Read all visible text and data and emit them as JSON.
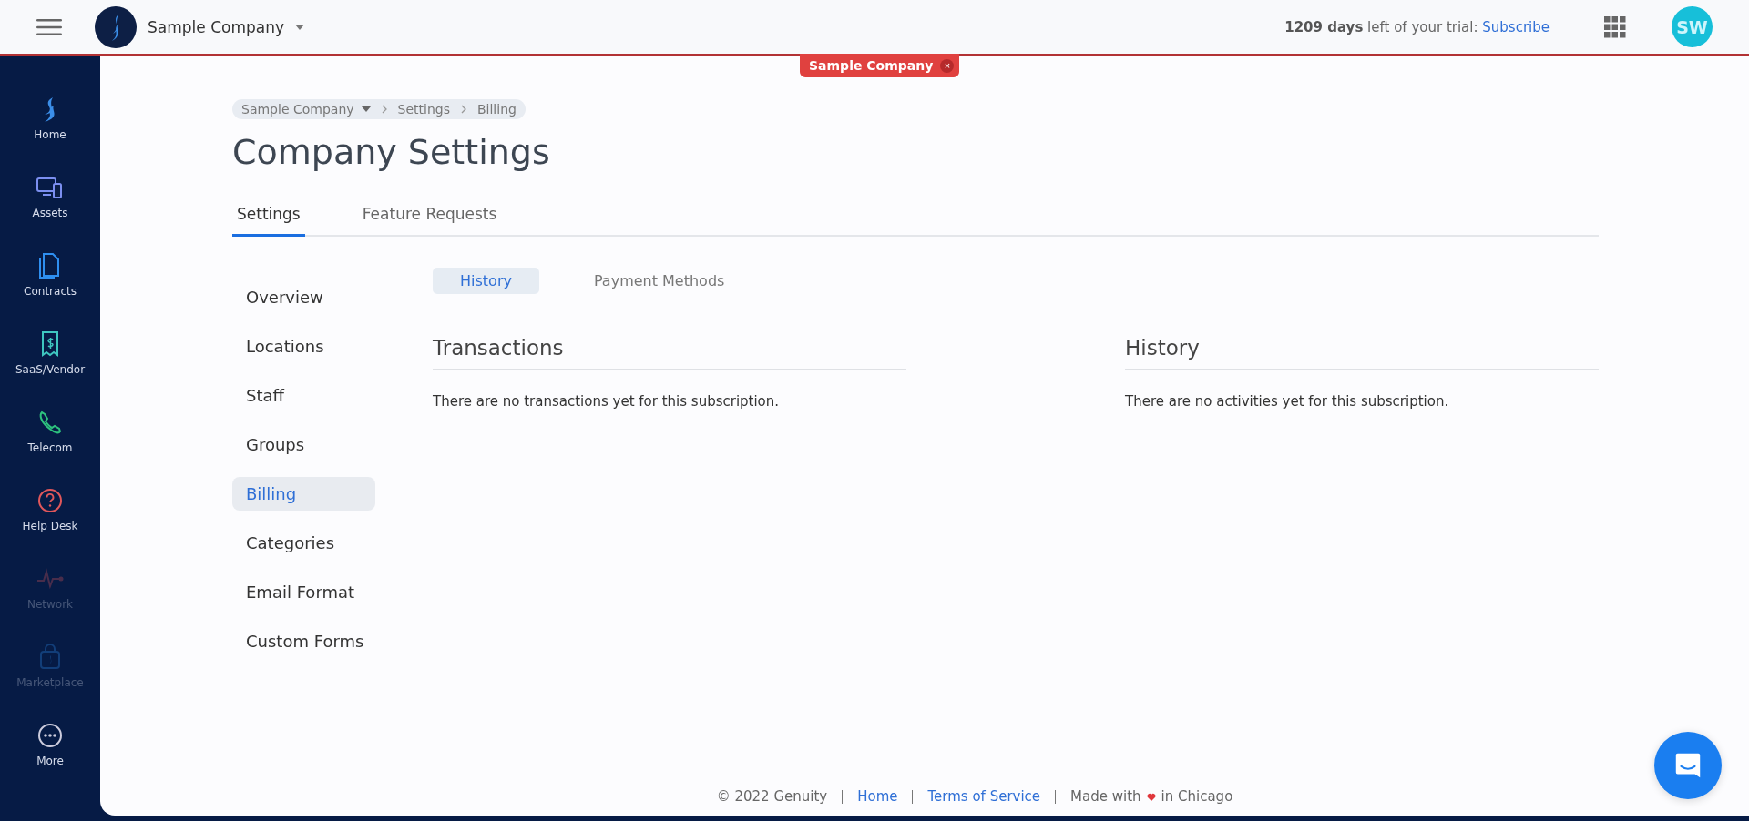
{
  "topbar": {
    "company": "Sample Company",
    "trial_days": "1209 days",
    "trial_text": "left of your trial:",
    "subscribe": "Subscribe",
    "avatar": "SW"
  },
  "company_badge": {
    "label": "Sample Company",
    "close": "×"
  },
  "sidebar": {
    "items": [
      {
        "label": "Home",
        "disabled": false
      },
      {
        "label": "Assets",
        "disabled": false
      },
      {
        "label": "Contracts",
        "disabled": false
      },
      {
        "label": "SaaS/Vendor",
        "disabled": false
      },
      {
        "label": "Telecom",
        "disabled": false
      },
      {
        "label": "Help Desk",
        "disabled": false
      },
      {
        "label": "Network",
        "disabled": true
      },
      {
        "label": "Marketplace",
        "disabled": true
      },
      {
        "label": "More",
        "disabled": false
      }
    ]
  },
  "breadcrumb": [
    "Sample Company",
    "Settings",
    "Billing"
  ],
  "title": "Company Settings",
  "tabs": [
    {
      "label": "Settings",
      "selected": true
    },
    {
      "label": "Feature Requests",
      "selected": false
    }
  ],
  "menu": [
    {
      "label": "Overview",
      "selected": false
    },
    {
      "label": "Locations",
      "selected": false
    },
    {
      "label": "Staff",
      "selected": false
    },
    {
      "label": "Groups",
      "selected": false
    },
    {
      "label": "Billing",
      "selected": true
    },
    {
      "label": "Categories",
      "selected": false
    },
    {
      "label": "Email Format",
      "selected": false
    },
    {
      "label": "Custom Forms",
      "selected": false
    }
  ],
  "subtabs": [
    {
      "label": "History",
      "selected": true
    },
    {
      "label": "Payment Methods",
      "selected": false
    }
  ],
  "panels": [
    {
      "title": "Transactions",
      "message": "There are no transactions yet for this subscription."
    },
    {
      "title": "History",
      "message": "There are no activities yet for this subscription."
    }
  ],
  "footer": {
    "copyright": "© 2022 Genuity",
    "links": [
      "Home",
      "Terms of Service"
    ],
    "made_before": "Made with",
    "made_after": "in Chicago"
  }
}
